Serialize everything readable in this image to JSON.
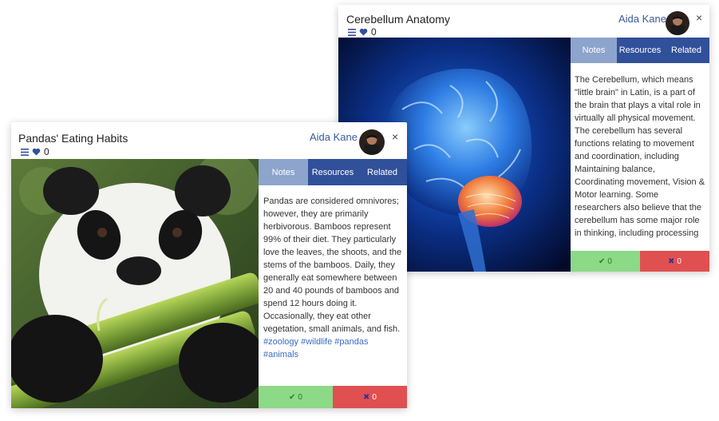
{
  "cards": [
    {
      "title": "Pandas' Eating Habits",
      "likes": "0",
      "author": "Aida Kane",
      "close": "×",
      "tabs": [
        "Notes",
        "Resources",
        "Related"
      ],
      "notes": "Pandas are considered omnivores; however, they are primarily herbivorous. Bamboos represent 99% of their diet. They particularly love the leaves, the shoots, and the stems of the bamboos. Daily, they generally eat somewhere between 20 and 40 pounds of bamboos and spend 12 hours doing it. Occasionally, they eat other vegetation, small animals, and fish.",
      "tags": "#zoology #wildlife #pandas #animals",
      "upvotes": "0",
      "downvotes": "0"
    },
    {
      "title": "Cerebellum Anatomy",
      "likes": "0",
      "author": "Aida Kane",
      "close": "×",
      "tabs": [
        "Notes",
        "Resources",
        "Related"
      ],
      "notes": "The Cerebellum, which means \"little brain\" in Latin, is a part of the brain that plays a vital role in virtually all physical movement. The cerebellum has several functions relating to movement and coordination, including Maintaining balance, Coordinating movement, Vision & Motor learning. Some researchers also believe that the cerebellum has some major role in thinking, including processing language and mood too. Like other structures in",
      "upvotes": "0",
      "downvotes": "0"
    }
  ],
  "colors": {
    "tab": "#31509a",
    "tab_active": "#8da4cc",
    "up": "#8cd987",
    "down": "#e05050",
    "link": "#3b6cc4"
  }
}
